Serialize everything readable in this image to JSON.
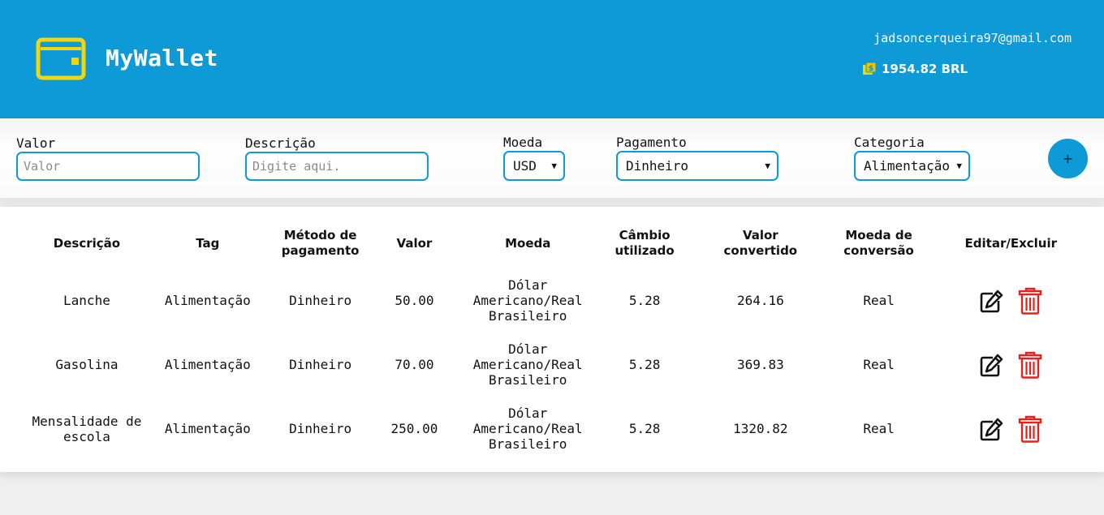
{
  "header": {
    "title": "MyWallet",
    "email": "jadsoncerqueira97@gmail.com",
    "balance": "1954.82 BRL",
    "logo_icon": "wallet-icon",
    "balance_icon": "money-icon",
    "colors": {
      "brand": "#0d9ad6",
      "accent": "#f5d60a"
    }
  },
  "form": {
    "valor_label": "Valor",
    "valor_placeholder": "Valor",
    "descricao_label": "Descrição",
    "descricao_placeholder": "Digite aqui.",
    "moeda_label": "Moeda",
    "moeda_value": "USD",
    "pagamento_label": "Pagamento",
    "pagamento_value": "Dinheiro",
    "categoria_label": "Categoria",
    "categoria_value": "Alimentação",
    "add_label": "+"
  },
  "table": {
    "headers": [
      "Descrição",
      "Tag",
      "Método de pagamento",
      "Valor",
      "Moeda",
      "Câmbio utilizado",
      "Valor convertido",
      "Moeda de conversão",
      "Editar/Excluir"
    ],
    "rows": [
      {
        "descricao": "Lanche",
        "tag": "Alimentação",
        "metodo": "Dinheiro",
        "valor": "50.00",
        "moeda": "Dólar Americano/Real Brasileiro",
        "cambio": "5.28",
        "convertido": "264.16",
        "conversao": "Real"
      },
      {
        "descricao": "Gasolina",
        "tag": "Alimentação",
        "metodo": "Dinheiro",
        "valor": "70.00",
        "moeda": "Dólar Americano/Real Brasileiro",
        "cambio": "5.28",
        "convertido": "369.83",
        "conversao": "Real"
      },
      {
        "descricao": "Mensalidade de escola",
        "tag": "Alimentação",
        "metodo": "Dinheiro",
        "valor": "250.00",
        "moeda": "Dólar Americano/Real Brasileiro",
        "cambio": "5.28",
        "convertido": "1320.82",
        "conversao": "Real"
      }
    ],
    "edit_icon": "edit-icon",
    "delete_icon": "trash-icon",
    "delete_color": "#e8201c"
  }
}
